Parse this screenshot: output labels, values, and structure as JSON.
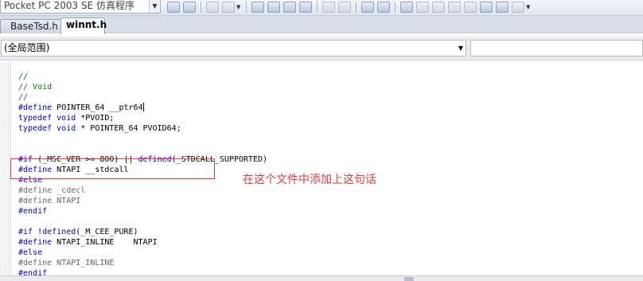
{
  "toolbar": {
    "platform": "Pocket PC 2003 SE 仿真程序",
    "buttons": [
      "icon-a",
      "icon-b",
      "icon-c",
      "icon-d",
      "icon-e",
      "icon-f",
      "icon-g",
      "icon-h",
      "icon-i",
      "icon-j",
      "icon-k",
      "icon-l",
      "icon-m",
      "icon-n",
      "icon-o",
      "icon-p",
      "icon-q"
    ]
  },
  "tabs": [
    "BaseTsd.h",
    "winnt.h"
  ],
  "scope": {
    "selected": "(全局范围)",
    "member": ""
  },
  "code": {
    "lines": [
      {
        "t": "//",
        "c": "cm"
      },
      {
        "t": "// Void",
        "c": "cm"
      },
      {
        "t": "//",
        "c": "cm"
      },
      {
        "parts": [
          {
            "t": "#define",
            "c": "pp"
          },
          {
            "t": " POINTER_64 __ptr64",
            "c": ""
          }
        ],
        "cursor": true
      },
      {
        "parts": [
          {
            "t": "typedef void",
            "c": "kw"
          },
          {
            "t": " *PVOID;",
            "c": ""
          }
        ]
      },
      {
        "parts": [
          {
            "t": "typedef void",
            "c": "kw"
          },
          {
            "t": " * POINTER_64 PVOID64;",
            "c": ""
          }
        ]
      },
      {
        "t": "",
        "c": ""
      },
      {
        "t": "",
        "c": ""
      },
      {
        "parts": [
          {
            "t": "#if",
            "c": "pp"
          },
          {
            "t": " (_MSC_VER >= 800) || ",
            "c": ""
          },
          {
            "t": "defined",
            "c": "kw"
          },
          {
            "t": "(_STDCALL_SUPPORTED)",
            "c": ""
          }
        ]
      },
      {
        "parts": [
          {
            "t": "#define",
            "c": "pp"
          },
          {
            "t": " NTAPI __stdcall",
            "c": ""
          }
        ]
      },
      {
        "t": "#else",
        "c": "pp"
      },
      {
        "t": "#define _cdecl",
        "c": "gray"
      },
      {
        "t": "#define NTAPI",
        "c": "gray"
      },
      {
        "t": "#endif",
        "c": "pp"
      },
      {
        "t": "",
        "c": ""
      },
      {
        "parts": [
          {
            "t": "#if",
            "c": "pp"
          },
          {
            "t": " !",
            "c": ""
          },
          {
            "t": "defined",
            "c": "kw"
          },
          {
            "t": "(_M_CEE_PURE)",
            "c": ""
          }
        ]
      },
      {
        "parts": [
          {
            "t": "#define",
            "c": "pp"
          },
          {
            "t": " NTAPI_INLINE    NTAPI",
            "c": ""
          }
        ]
      },
      {
        "t": "#else",
        "c": "pp"
      },
      {
        "t": "#define NTAPI_INLINE",
        "c": "gray"
      },
      {
        "t": "#endif",
        "c": "pp"
      }
    ]
  },
  "annotation": "在这个文件中添加上这句话"
}
